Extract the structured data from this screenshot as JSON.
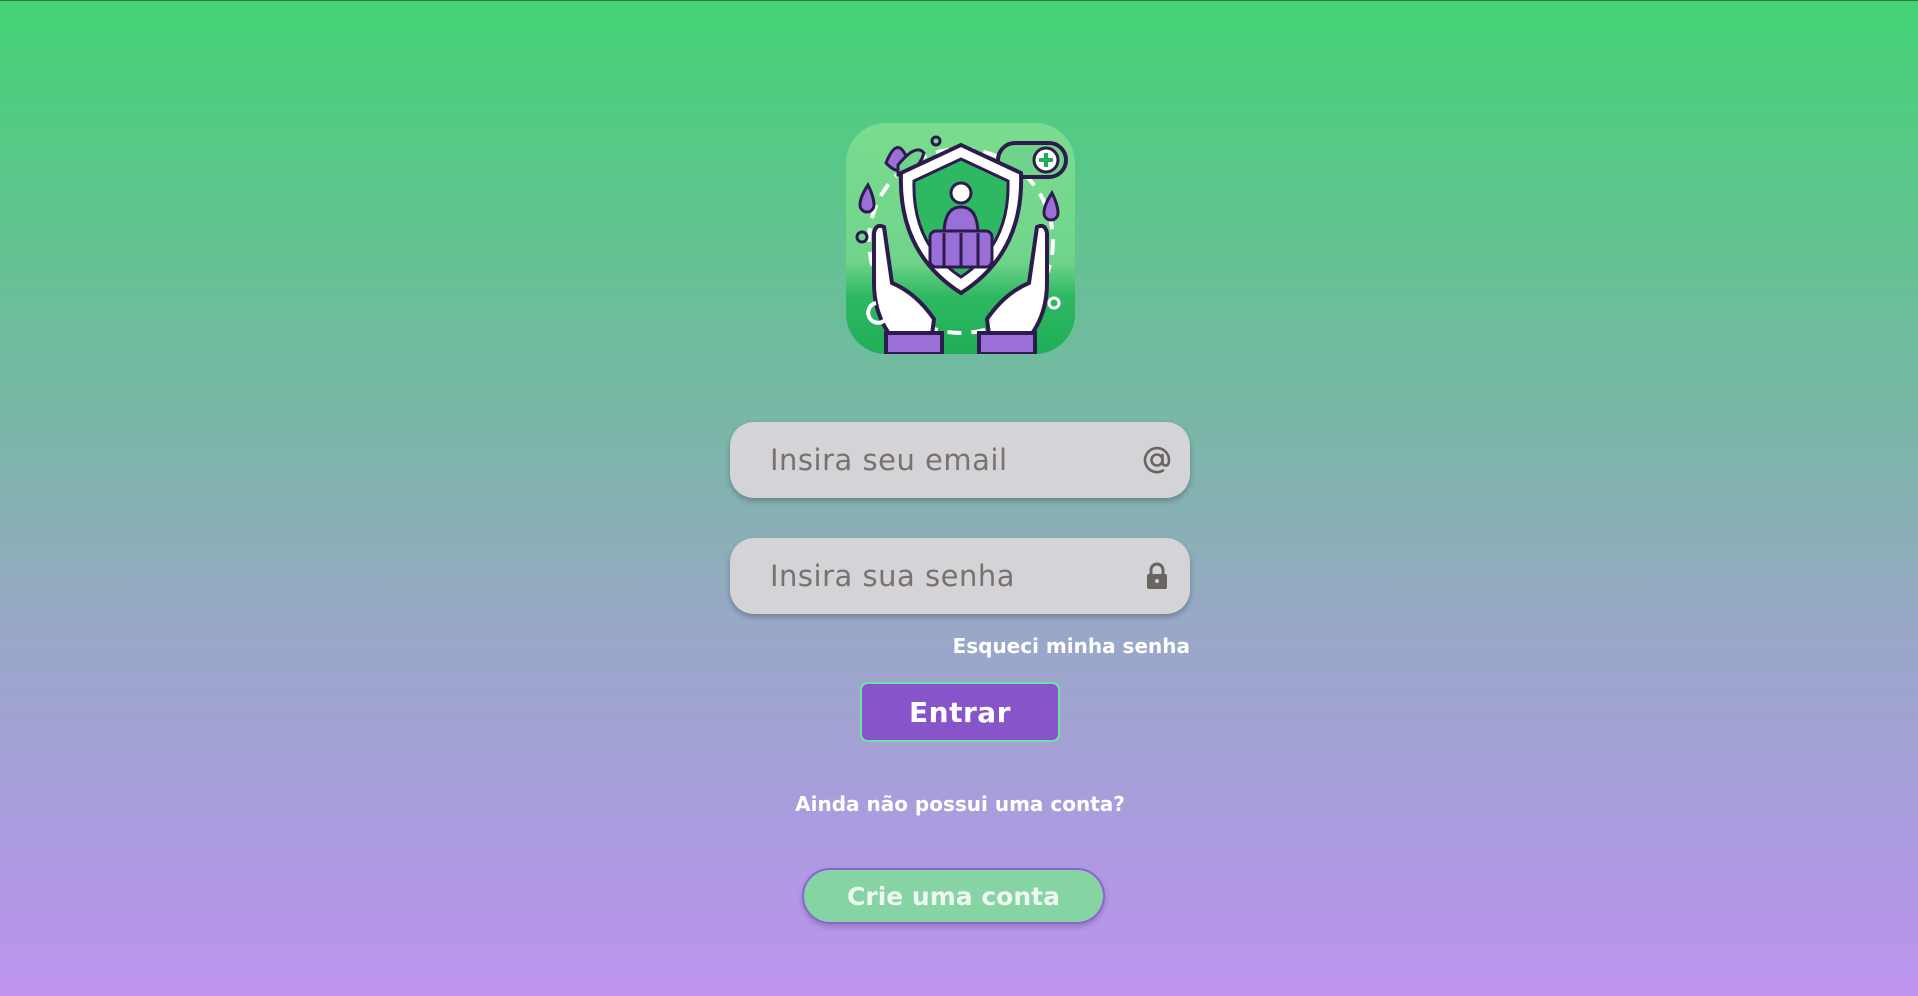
{
  "login": {
    "email": {
      "placeholder": "Insira seu email",
      "value": "",
      "icon": "at-icon"
    },
    "password": {
      "placeholder": "Insira sua senha",
      "value": "",
      "icon": "lock-icon"
    },
    "forgot_password": "Esqueci minha senha",
    "enter_label": "Entrar",
    "no_account_text": "Ainda não possui uma conta?",
    "create_account_label": "Crie uma conta"
  },
  "colors": {
    "gradient_top": "#44d375",
    "gradient_bottom": "#bd93ef",
    "primary_purple": "#8755c9",
    "accent_green": "#86d4a4",
    "field_bg": "#d4d3d8"
  }
}
